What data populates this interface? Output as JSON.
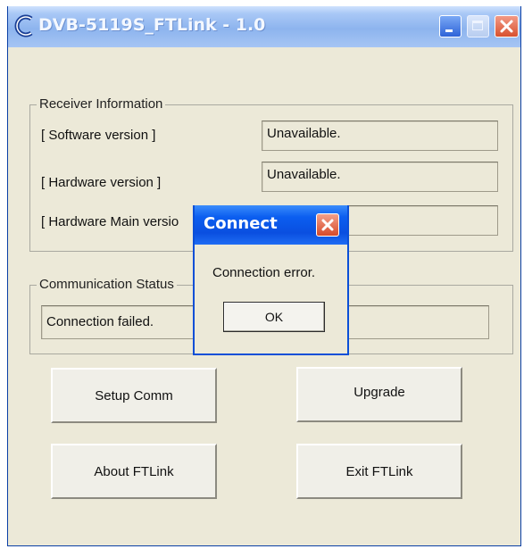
{
  "window": {
    "title": "DVB-5119S_FTLink - 1.0",
    "icons": {
      "app": "c-logo-icon",
      "minimize": "minimize-icon",
      "maximize": "maximize-icon",
      "close": "close-icon"
    }
  },
  "receiver_info": {
    "group_title": "Receiver Information",
    "software_label": "[ Software version ]",
    "software_value": "Unavailable.",
    "hardware_label": "[ Hardware version ]",
    "hardware_value": "Unavailable.",
    "hardware_main_label": "[ Hardware Main versio",
    "hardware_main_value": ""
  },
  "communication": {
    "group_title": "Communication Status",
    "status_value": "Connection failed."
  },
  "buttons": {
    "setup_comm": "Setup Comm",
    "upgrade": "Upgrade",
    "about": "About FTLink",
    "exit": "Exit FTLink"
  },
  "dialog": {
    "title": "Connect",
    "message": "Connection error.",
    "ok_label": "OK"
  },
  "colors": {
    "window_bg": "#ece9d8",
    "dialog_title": "#0b5ef0",
    "close_red": "#d74a2a"
  }
}
